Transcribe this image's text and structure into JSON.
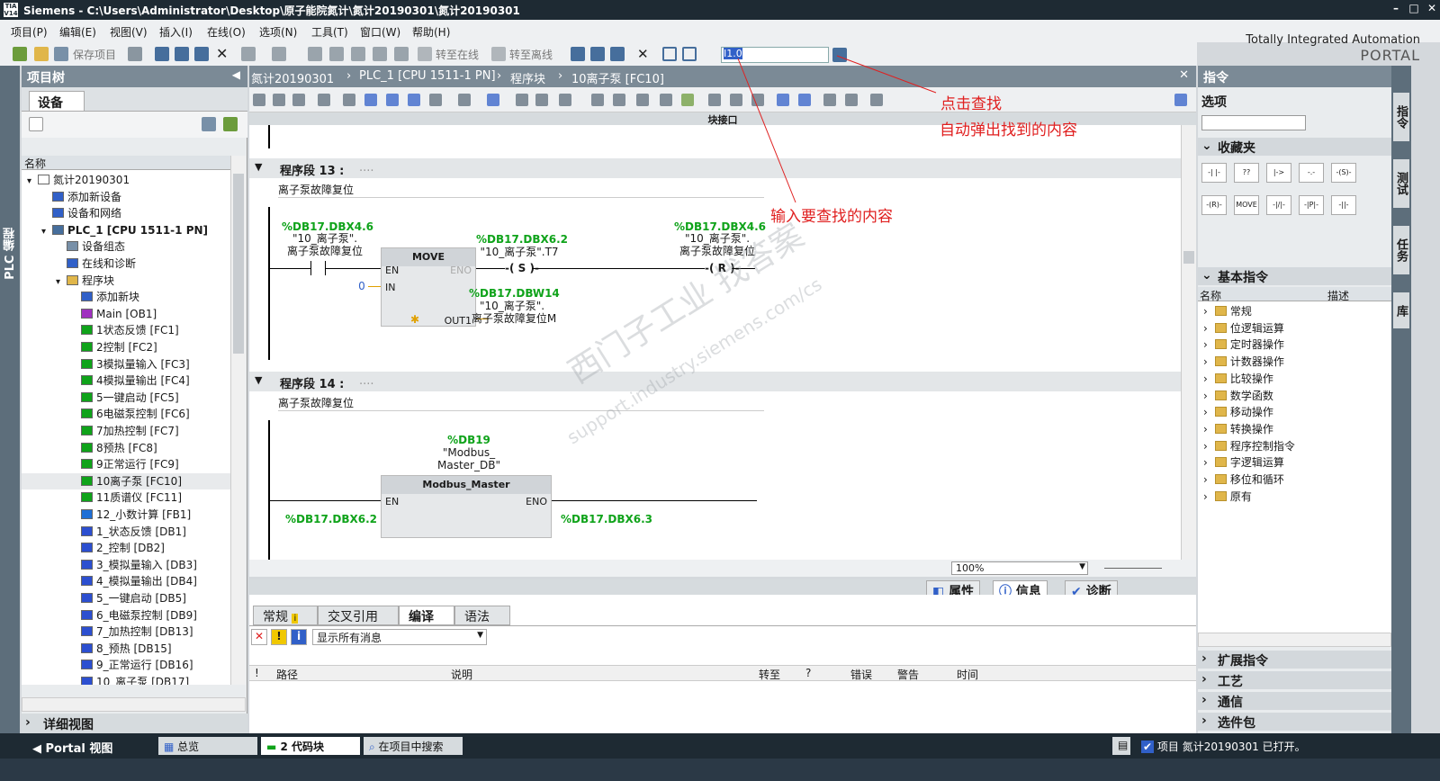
{
  "window": {
    "app": "Siemens",
    "title": "Siemens  -  C:\\Users\\Administrator\\Desktop\\原子能院氮计\\氮计20190301\\氮计20190301"
  },
  "menu": [
    "项目(P)",
    "编辑(E)",
    "视图(V)",
    "插入(I)",
    "在线(O)",
    "选项(N)",
    "工具(T)",
    "窗口(W)",
    "帮助(H)"
  ],
  "brand": {
    "line1": "Totally Integrated Automation",
    "line2": "PORTAL"
  },
  "toolbar": {
    "save_project": "保存项目",
    "go_online": "转至在线",
    "go_offline": "转至离线",
    "search_value": "I1.0"
  },
  "left_strip": "PLC 编程",
  "project_tree": {
    "header": "项目树",
    "tab": "设备",
    "col_name": "名称",
    "items": [
      {
        "label": "氮计20190301",
        "level": 0,
        "icon": "project",
        "expanded": true
      },
      {
        "label": "添加新设备",
        "level": 1,
        "icon": "add-device"
      },
      {
        "label": "设备和网络",
        "level": 1,
        "icon": "network"
      },
      {
        "label": "PLC_1 [CPU 1511-1 PN]",
        "level": 1,
        "icon": "cpu",
        "expanded": true,
        "bold": true
      },
      {
        "label": "设备组态",
        "level": 2,
        "icon": "config"
      },
      {
        "label": "在线和诊断",
        "level": 2,
        "icon": "diag"
      },
      {
        "label": "程序块",
        "level": 2,
        "icon": "folder",
        "expanded": true
      },
      {
        "label": "添加新块",
        "level": 3,
        "icon": "add-block"
      },
      {
        "label": "Main [OB1]",
        "level": 3,
        "icon": "ob"
      },
      {
        "label": "1状态反馈 [FC1]",
        "level": 3,
        "icon": "fc"
      },
      {
        "label": "2控制 [FC2]",
        "level": 3,
        "icon": "fc"
      },
      {
        "label": "3模拟量输入 [FC3]",
        "level": 3,
        "icon": "fc"
      },
      {
        "label": "4模拟量输出 [FC4]",
        "level": 3,
        "icon": "fc"
      },
      {
        "label": "5一键启动 [FC5]",
        "level": 3,
        "icon": "fc"
      },
      {
        "label": "6电磁泵控制 [FC6]",
        "level": 3,
        "icon": "fc"
      },
      {
        "label": "7加热控制 [FC7]",
        "level": 3,
        "icon": "fc"
      },
      {
        "label": "8预热 [FC8]",
        "level": 3,
        "icon": "fc"
      },
      {
        "label": "9正常运行 [FC9]",
        "level": 3,
        "icon": "fc"
      },
      {
        "label": "10离子泵 [FC10]",
        "level": 3,
        "icon": "fc",
        "selected": true
      },
      {
        "label": "11质谱仪 [FC11]",
        "level": 3,
        "icon": "fc"
      },
      {
        "label": "12_小数计算 [FB1]",
        "level": 3,
        "icon": "fb"
      },
      {
        "label": "1_状态反馈 [DB1]",
        "level": 3,
        "icon": "db"
      },
      {
        "label": "2_控制 [DB2]",
        "level": 3,
        "icon": "db"
      },
      {
        "label": "3_模拟量输入 [DB3]",
        "level": 3,
        "icon": "db"
      },
      {
        "label": "4_模拟量输出 [DB4]",
        "level": 3,
        "icon": "db"
      },
      {
        "label": "5_一键启动 [DB5]",
        "level": 3,
        "icon": "db"
      },
      {
        "label": "6_电磁泵控制 [DB9]",
        "level": 3,
        "icon": "db"
      },
      {
        "label": "7_加热控制 [DB13]",
        "level": 3,
        "icon": "db"
      },
      {
        "label": "8_预热 [DB15]",
        "level": 3,
        "icon": "db"
      },
      {
        "label": "9_正常运行 [DB16]",
        "level": 3,
        "icon": "db"
      },
      {
        "label": "10_离子泵 [DB17]",
        "level": 3,
        "icon": "db"
      }
    ],
    "detail_view": "详细视图"
  },
  "editor": {
    "breadcrumb": [
      "氮计20190301",
      "PLC_1 [CPU 1511-1 PN]",
      "程序块",
      "10离子泵 [FC10]"
    ],
    "block_interface": "块接口",
    "zoom": "100%",
    "segments": [
      {
        "title": "程序段 13 :",
        "title_dots": "....",
        "comment": "离子泵故障复位",
        "contact": {
          "addr": "%DB17.DBX4.6",
          "name": "\"10_离子泵\".",
          "member": "离子泵故障复位"
        },
        "move_box": {
          "title": "MOVE",
          "en": "EN",
          "eno": "ENO",
          "in": "IN",
          "out": "OUT1",
          "in_value": "0"
        },
        "set_coil": {
          "addr": "%DB17.DBX6.2",
          "name": "\"10_离子泵\".T7",
          "symbol": "S"
        },
        "out_operand": {
          "addr": "%DB17.DBW14",
          "name": "\"10_离子泵\".",
          "member": "离子泵故障复位M"
        },
        "reset_coil": {
          "addr": "%DB17.DBX4.6",
          "name": "\"10_离子泵\".",
          "member": "离子泵故障复位",
          "symbol": "R"
        }
      },
      {
        "title": "程序段 14 :",
        "title_dots": "....",
        "comment": "离子泵故障复位",
        "instance_db": {
          "addr": "%DB19",
          "name": "\"Modbus_",
          "name2": "Master_DB\""
        },
        "box": {
          "title": "Modbus_Master",
          "en": "EN",
          "eno": "ENO"
        },
        "left_operand": "%DB17.DBX6.2",
        "right_operand": "%DB17.DBX6.3"
      }
    ]
  },
  "inspector": {
    "tabs": [
      "属性",
      "信息",
      "诊断"
    ],
    "subtabs": [
      "常规",
      "交叉引用",
      "编译",
      "语法"
    ],
    "active_subtab": "编译",
    "filter": "显示所有消息",
    "columns": [
      "!",
      "路径",
      "说明",
      "转至",
      "?",
      "错误",
      "警告",
      "时间"
    ]
  },
  "instructions": {
    "header": "指令",
    "options": "选项",
    "favorites": "收藏夹",
    "fav_items": [
      "-| |-",
      "??",
      "|->",
      "-.-",
      "-(S)-",
      "-(R)-",
      "MOVE",
      "-|/|-",
      "-|P|-",
      "-||-"
    ],
    "basic": "基本指令",
    "col_name": "名称",
    "col_desc": "描述",
    "items": [
      "常规",
      "位逻辑运算",
      "定时器操作",
      "计数器操作",
      "比较操作",
      "数学函数",
      "移动操作",
      "转换操作",
      "程序控制指令",
      "字逻辑运算",
      "移位和循环",
      "原有"
    ],
    "sections": [
      "扩展指令",
      "工艺",
      "通信",
      "选件包"
    ]
  },
  "right_tabs": [
    "指令",
    "测试",
    "任务",
    "库"
  ],
  "statusbar": {
    "portal": "Portal 视图",
    "overview": "总览",
    "code_block": "2 代码块",
    "search": "在项目中搜索",
    "project_open": "项目 氮计20190301 已打开。"
  },
  "annotations": {
    "click_search": "点击查找",
    "auto_popup": "自动弹出找到的内容",
    "input_search": "输入要查找的内容"
  },
  "watermark": {
    "cn": "西门子工业 找答案",
    "url": "support.industry.siemens.com/cs"
  }
}
